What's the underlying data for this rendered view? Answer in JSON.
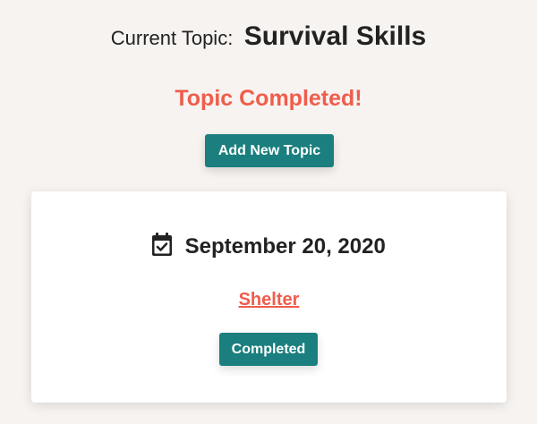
{
  "header": {
    "prefix": "Current Topic:",
    "topic": "Survival Skills"
  },
  "status": {
    "message": "Topic Completed!"
  },
  "actions": {
    "add_topic_label": "Add New Topic"
  },
  "entry": {
    "date_icon": "calendar-check-icon",
    "date": "September 20, 2020",
    "item": "Shelter",
    "state_label": "Completed"
  },
  "colors": {
    "accent": "#ef5d4b",
    "primary_button": "#1a7f7e",
    "background": "#f7f3f1",
    "card": "#ffffff"
  }
}
